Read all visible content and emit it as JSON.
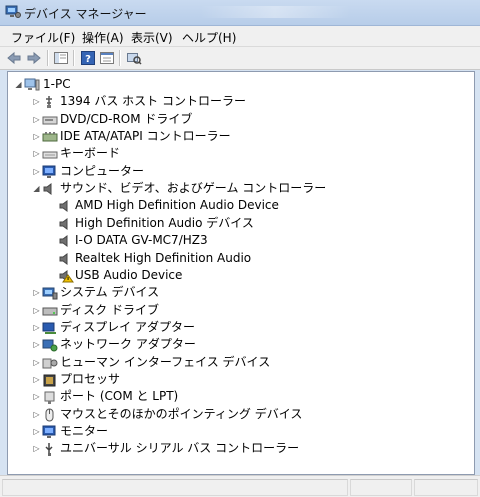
{
  "window": {
    "title": "デバイス マネージャー"
  },
  "menu": [
    {
      "label": "ファイル(F)"
    },
    {
      "label": "操作(A)"
    },
    {
      "label": "表示(V)"
    },
    {
      "label": "ヘルプ(H)"
    }
  ],
  "toolbar": {
    "buttons": [
      {
        "icon": "back-arrow-icon"
      },
      {
        "icon": "forward-arrow-icon"
      },
      {
        "icon": "show-hide-console-tree-icon"
      },
      {
        "icon": "help-icon"
      },
      {
        "icon": "properties-icon"
      },
      {
        "icon": "scan-hardware-icon"
      }
    ]
  },
  "tree": {
    "root": {
      "label": "1-PC",
      "icon": "computer-icon"
    },
    "categories": [
      {
        "label": "1394 バス ホスト コントローラー",
        "icon": "firewire-icon",
        "expanded": false
      },
      {
        "label": "DVD/CD-ROM ドライブ",
        "icon": "dvd-drive-icon",
        "expanded": false
      },
      {
        "label": "IDE ATA/ATAPI コントローラー",
        "icon": "ide-controller-icon",
        "expanded": false
      },
      {
        "label": "キーボード",
        "icon": "keyboard-icon",
        "expanded": false
      },
      {
        "label": "コンピューター",
        "icon": "monitor-icon",
        "expanded": false
      },
      {
        "label": "サウンド、ビデオ、およびゲーム コントローラー",
        "icon": "speaker-icon",
        "expanded": true,
        "children": [
          {
            "label": "AMD High Definition Audio Device",
            "icon": "speaker-icon",
            "warning": false
          },
          {
            "label": "High Definition Audio デバイス",
            "icon": "speaker-icon",
            "warning": false
          },
          {
            "label": "I-O DATA GV-MC7/HZ3",
            "icon": "speaker-icon",
            "warning": false
          },
          {
            "label": "Realtek High Definition Audio",
            "icon": "speaker-icon",
            "warning": false
          },
          {
            "label": "USB Audio Device",
            "icon": "speaker-warning-icon",
            "warning": true
          }
        ]
      },
      {
        "label": "システム デバイス",
        "icon": "system-devices-icon",
        "expanded": false
      },
      {
        "label": "ディスク ドライブ",
        "icon": "disk-drive-icon",
        "expanded": false
      },
      {
        "label": "ディスプレイ アダプター",
        "icon": "display-adapter-icon",
        "expanded": false
      },
      {
        "label": "ネットワーク アダプター",
        "icon": "network-adapter-icon",
        "expanded": false
      },
      {
        "label": "ヒューマン インターフェイス デバイス",
        "icon": "hid-icon",
        "expanded": false
      },
      {
        "label": "プロセッサ",
        "icon": "processor-icon",
        "expanded": false
      },
      {
        "label": "ポート (COM と LPT)",
        "icon": "port-icon",
        "expanded": false
      },
      {
        "label": "マウスとそのほかのポインティング デバイス",
        "icon": "mouse-icon",
        "expanded": false
      },
      {
        "label": "モニター",
        "icon": "monitor-icon",
        "expanded": false
      },
      {
        "label": "ユニバーサル シリアル バス コントローラー",
        "icon": "usb-icon",
        "expanded": false
      }
    ]
  },
  "colors": {
    "accent": "#1e5aa8",
    "warning": "#f2c200"
  }
}
